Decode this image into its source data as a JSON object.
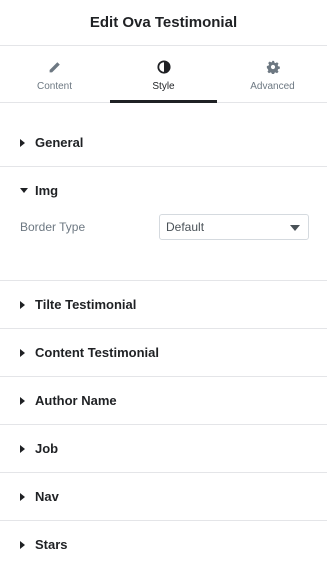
{
  "header": {
    "title": "Edit Ova Testimonial"
  },
  "tabs": [
    {
      "label": "Content",
      "icon": "pencil-icon"
    },
    {
      "label": "Style",
      "icon": "half-circle-icon",
      "active": true
    },
    {
      "label": "Advanced",
      "icon": "gear-icon"
    }
  ],
  "sections": {
    "general": {
      "title": "General"
    },
    "img": {
      "title": "Img",
      "border_type": {
        "label": "Border Type",
        "value": "Default"
      }
    },
    "tilte_testimonial": {
      "title": "Tilte Testimonial"
    },
    "content_testimonial": {
      "title": "Content Testimonial"
    },
    "author_name": {
      "title": "Author Name"
    },
    "job": {
      "title": "Job"
    },
    "nav": {
      "title": "Nav"
    },
    "stars": {
      "title": "Stars"
    }
  },
  "colors": {
    "accent": "#1f2124",
    "label": "#6d7882",
    "border": "#e4e5e8"
  }
}
